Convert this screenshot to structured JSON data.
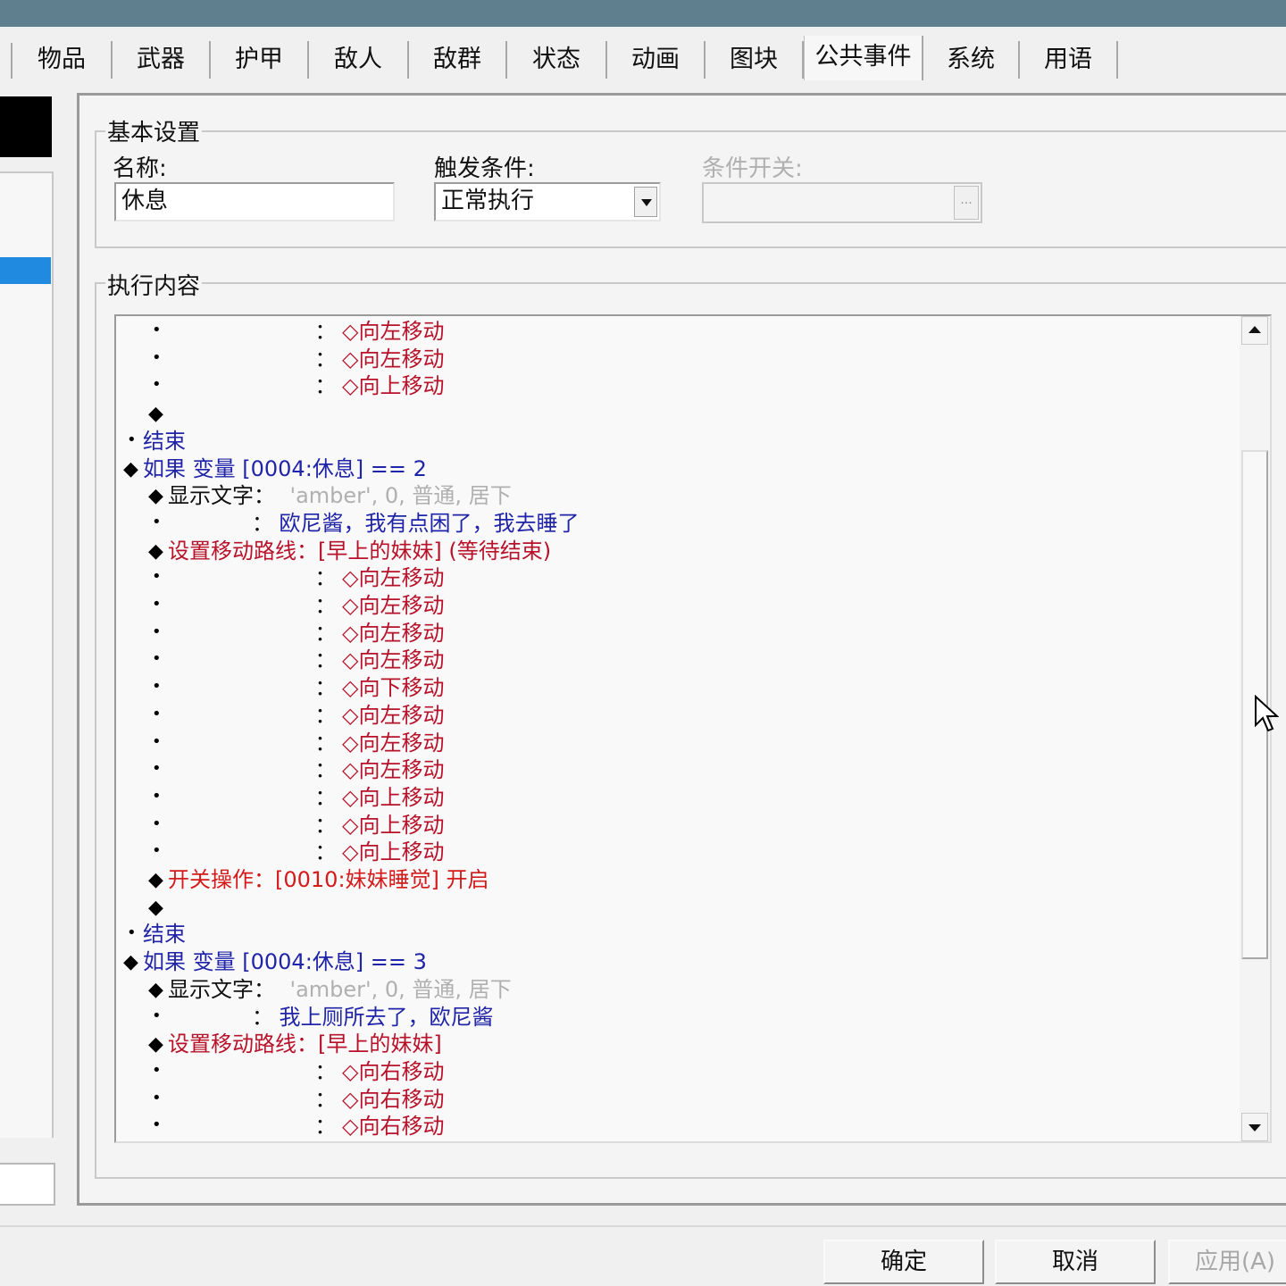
{
  "tabs": [
    "物品",
    "武器",
    "护甲",
    "敌人",
    "敌群",
    "状态",
    "动画",
    "图块",
    "公共事件",
    "系统",
    "用语"
  ],
  "active_tab": "公共事件",
  "basic": {
    "group_title": "基本设置",
    "name_label": "名称:",
    "name_value": "休息",
    "trigger_label": "触发条件:",
    "trigger_value": "正常执行",
    "switch_label": "条件开关:",
    "switch_value": "",
    "ellipsis": "..."
  },
  "contents": {
    "group_title": "执行内容",
    "lines": [
      {
        "marker": "•",
        "indent": 2,
        "segments": [
          {
            "text": "：",
            "color": "black",
            "pad": 7
          },
          {
            "text": "◇向左移动",
            "color": "red"
          }
        ]
      },
      {
        "marker": "•",
        "indent": 2,
        "segments": [
          {
            "text": "：",
            "color": "black",
            "pad": 7
          },
          {
            "text": "◇向左移动",
            "color": "red"
          }
        ]
      },
      {
        "marker": "•",
        "indent": 2,
        "segments": [
          {
            "text": "：",
            "color": "black",
            "pad": 7
          },
          {
            "text": "◇向上移动",
            "color": "red"
          }
        ]
      },
      {
        "marker": "◆",
        "indent": 2,
        "segments": []
      },
      {
        "marker": "•",
        "indent": 0,
        "segments": [
          {
            "text": "结束",
            "color": "blue"
          }
        ]
      },
      {
        "marker": "◆",
        "indent": 0,
        "segments": [
          {
            "text": "如果 变量 [0004:休息] == 2",
            "color": "blue"
          }
        ]
      },
      {
        "marker": "◆",
        "indent": 1,
        "segments": [
          {
            "text": "显示文字：",
            "color": "black"
          },
          {
            "text": "'amber', 0, 普通, 居下",
            "color": "gray"
          }
        ]
      },
      {
        "marker": "•",
        "indent": 1,
        "segments": [
          {
            "text": "：",
            "color": "black",
            "pad": 4
          },
          {
            "text": "欧尼酱，我有点困了，我去睡了",
            "color": "blue"
          }
        ]
      },
      {
        "marker": "◆",
        "indent": 1,
        "segments": [
          {
            "text": "设置移动路线：[早上的妹妹] (等待结束)",
            "color": "red"
          }
        ]
      },
      {
        "marker": "•",
        "indent": 2,
        "segments": [
          {
            "text": "：",
            "color": "black",
            "pad": 7
          },
          {
            "text": "◇向左移动",
            "color": "red"
          }
        ]
      },
      {
        "marker": "•",
        "indent": 2,
        "segments": [
          {
            "text": "：",
            "color": "black",
            "pad": 7
          },
          {
            "text": "◇向左移动",
            "color": "red"
          }
        ]
      },
      {
        "marker": "•",
        "indent": 2,
        "segments": [
          {
            "text": "：",
            "color": "black",
            "pad": 7
          },
          {
            "text": "◇向左移动",
            "color": "red"
          }
        ]
      },
      {
        "marker": "•",
        "indent": 2,
        "segments": [
          {
            "text": "：",
            "color": "black",
            "pad": 7
          },
          {
            "text": "◇向左移动",
            "color": "red"
          }
        ]
      },
      {
        "marker": "•",
        "indent": 2,
        "segments": [
          {
            "text": "：",
            "color": "black",
            "pad": 7
          },
          {
            "text": "◇向下移动",
            "color": "red"
          }
        ]
      },
      {
        "marker": "•",
        "indent": 2,
        "segments": [
          {
            "text": "：",
            "color": "black",
            "pad": 7
          },
          {
            "text": "◇向左移动",
            "color": "red"
          }
        ]
      },
      {
        "marker": "•",
        "indent": 2,
        "segments": [
          {
            "text": "：",
            "color": "black",
            "pad": 7
          },
          {
            "text": "◇向左移动",
            "color": "red"
          }
        ]
      },
      {
        "marker": "•",
        "indent": 2,
        "segments": [
          {
            "text": "：",
            "color": "black",
            "pad": 7
          },
          {
            "text": "◇向左移动",
            "color": "red"
          }
        ]
      },
      {
        "marker": "•",
        "indent": 2,
        "segments": [
          {
            "text": "：",
            "color": "black",
            "pad": 7
          },
          {
            "text": "◇向上移动",
            "color": "red"
          }
        ]
      },
      {
        "marker": "•",
        "indent": 2,
        "segments": [
          {
            "text": "：",
            "color": "black",
            "pad": 7
          },
          {
            "text": "◇向上移动",
            "color": "red"
          }
        ]
      },
      {
        "marker": "•",
        "indent": 2,
        "segments": [
          {
            "text": "：",
            "color": "black",
            "pad": 7
          },
          {
            "text": "◇向上移动",
            "color": "red"
          }
        ]
      },
      {
        "marker": "◆",
        "indent": 1,
        "segments": [
          {
            "text": "开关操作：[0010:妹妹睡觉] 开启",
            "color": "bright"
          }
        ]
      },
      {
        "marker": "◆",
        "indent": 1,
        "segments": []
      },
      {
        "marker": "•",
        "indent": 0,
        "segments": [
          {
            "text": "结束",
            "color": "blue"
          }
        ]
      },
      {
        "marker": "◆",
        "indent": 0,
        "segments": [
          {
            "text": "如果 变量 [0004:休息] == 3",
            "color": "blue"
          }
        ]
      },
      {
        "marker": "◆",
        "indent": 1,
        "segments": [
          {
            "text": "显示文字：",
            "color": "black"
          },
          {
            "text": "'amber', 0, 普通, 居下",
            "color": "gray"
          }
        ]
      },
      {
        "marker": "•",
        "indent": 1,
        "segments": [
          {
            "text": "：",
            "color": "black",
            "pad": 4
          },
          {
            "text": "我上厕所去了，欧尼酱",
            "color": "blue"
          }
        ]
      },
      {
        "marker": "◆",
        "indent": 1,
        "segments": [
          {
            "text": "设置移动路线：[早上的妹妹]",
            "color": "red"
          }
        ]
      },
      {
        "marker": "•",
        "indent": 2,
        "segments": [
          {
            "text": "：",
            "color": "black",
            "pad": 7
          },
          {
            "text": "◇向右移动",
            "color": "red"
          }
        ]
      },
      {
        "marker": "•",
        "indent": 2,
        "segments": [
          {
            "text": "：",
            "color": "black",
            "pad": 7
          },
          {
            "text": "◇向右移动",
            "color": "red"
          }
        ]
      },
      {
        "marker": "•",
        "indent": 2,
        "segments": [
          {
            "text": "：",
            "color": "black",
            "pad": 7
          },
          {
            "text": "◇向右移动",
            "color": "red"
          }
        ]
      }
    ]
  },
  "buttons": {
    "ok": "确定",
    "cancel": "取消",
    "apply": "应用(A)"
  },
  "colors": {
    "blue": "#1f24a8",
    "red": "#b8122a",
    "bright": "#d41a1a",
    "gray": "#b0b0b0",
    "black": "#111111",
    "selection": "#1f8ae0"
  }
}
